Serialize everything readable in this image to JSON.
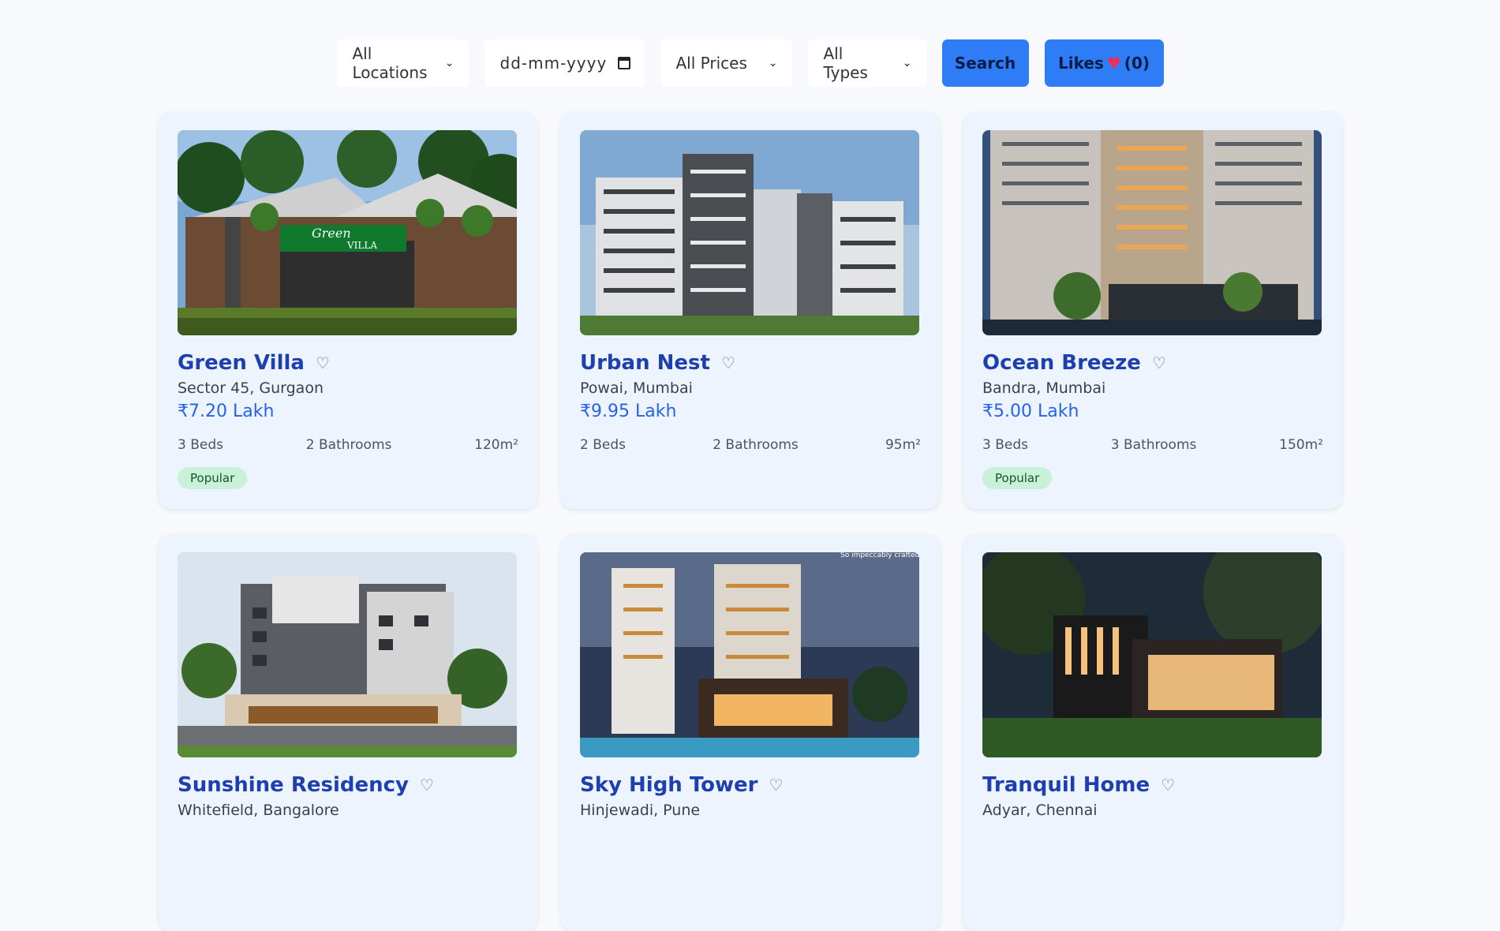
{
  "filters": {
    "location": "All Locations",
    "date_placeholder": "dd-mm-yyyy",
    "price": "All Prices",
    "type": "All Types",
    "search_label": "Search",
    "likes_label": "Likes",
    "likes_count": "(0)"
  },
  "properties": [
    {
      "name": "Green Villa",
      "location": "Sector 45, Gurgaon",
      "price": "₹7.20 Lakh",
      "beds": "3 Beds",
      "baths": "2 Bathrooms",
      "area": "120m²",
      "badge": "Popular"
    },
    {
      "name": "Urban Nest",
      "location": "Powai, Mumbai",
      "price": "₹9.95 Lakh",
      "beds": "2 Beds",
      "baths": "2 Bathrooms",
      "area": "95m²",
      "badge": ""
    },
    {
      "name": "Ocean Breeze",
      "location": "Bandra, Mumbai",
      "price": "₹5.00 Lakh",
      "beds": "3 Beds",
      "baths": "3 Bathrooms",
      "area": "150m²",
      "badge": "Popular"
    },
    {
      "name": "Sunshine Residency",
      "location": "Whitefield, Bangalore"
    },
    {
      "name": "Sky High Tower",
      "location": "Hinjewadi, Pune"
    },
    {
      "name": "Tranquil Home",
      "location": "Adyar, Chennai"
    }
  ],
  "image_texts": {
    "green_villa_sign_1": "Green",
    "green_villa_sign_2": "VILLA",
    "sky_high_caption": "So impeccably crafted"
  },
  "colors": {
    "accent": "#2f7df6",
    "title": "#1d3fb0",
    "price": "#2563eb",
    "badge_bg": "#c8f1d8",
    "heart": "#ef2d56"
  }
}
